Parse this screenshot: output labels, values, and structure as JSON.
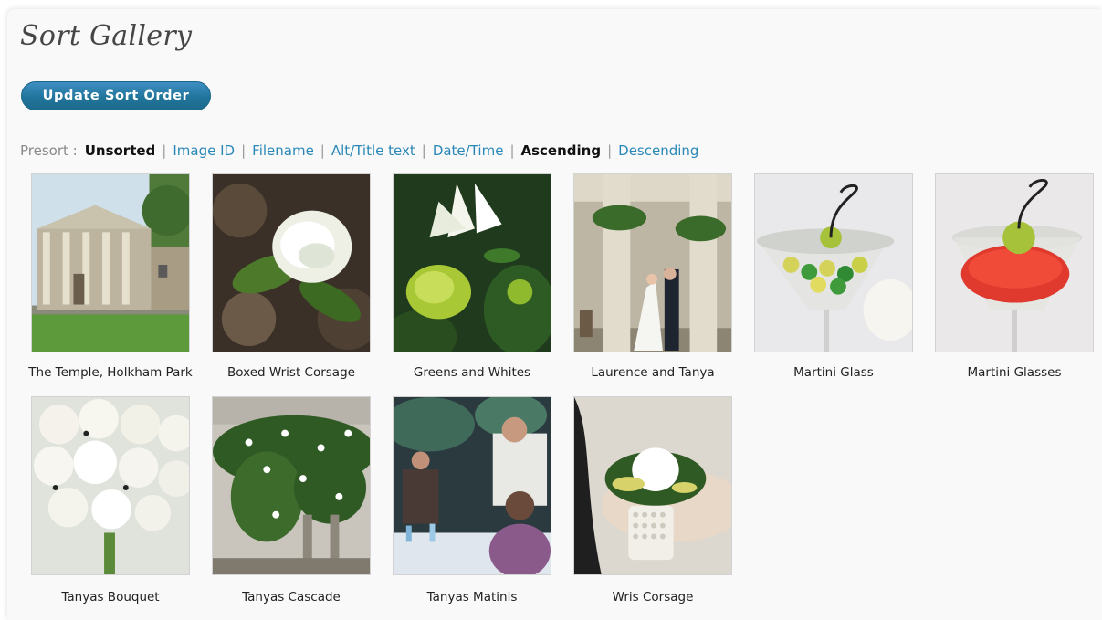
{
  "page": {
    "title": "Sort Gallery",
    "update_button": "Update Sort Order"
  },
  "presort": {
    "label": "Presort :",
    "options": [
      "Unsorted",
      "Image ID",
      "Filename",
      "Alt/Title text",
      "Date/Time",
      "Ascending",
      "Descending"
    ],
    "active": [
      "Unsorted",
      "Ascending"
    ]
  },
  "gallery": {
    "items": [
      {
        "caption": "The Temple, Holkham Park",
        "thumb": "temple"
      },
      {
        "caption": "Boxed Wrist Corsage",
        "thumb": "rose-dark"
      },
      {
        "caption": "Greens and Whites",
        "thumb": "lilies"
      },
      {
        "caption": "Laurence and Tanya",
        "thumb": "couple"
      },
      {
        "caption": "Martini Glass",
        "thumb": "martini-green"
      },
      {
        "caption": "Martini Glasses",
        "thumb": "martini-red"
      },
      {
        "caption": "Tanyas Bouquet",
        "thumb": "bouquet"
      },
      {
        "caption": "Tanyas Cascade",
        "thumb": "cascade"
      },
      {
        "caption": "Tanyas Matinis",
        "thumb": "party"
      },
      {
        "caption": "Wris Corsage",
        "thumb": "wrist-corsage"
      }
    ]
  }
}
